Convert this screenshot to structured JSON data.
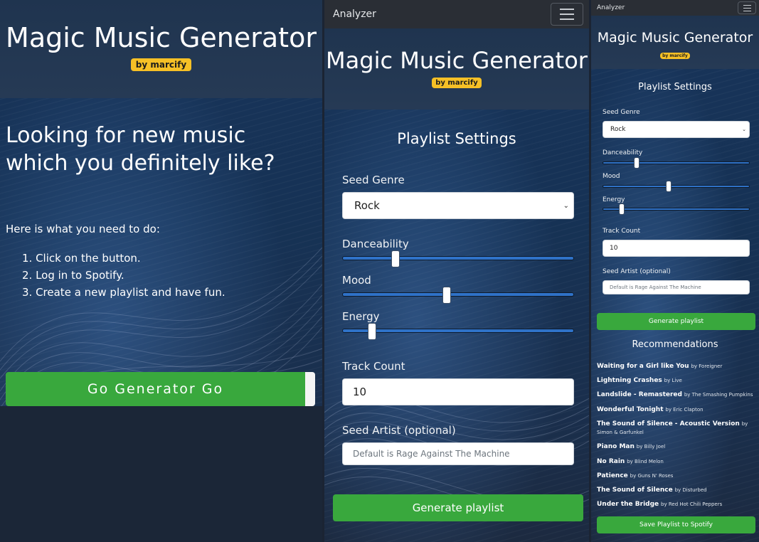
{
  "panel1": {
    "title": "Magic Music Generator",
    "badge": "by marcify",
    "headline": "Looking for new music which you definitely like?",
    "intro": "Here is what you need to do:",
    "steps": [
      "1. Click on the button.",
      "2. Log in to Spotify.",
      "3. Create a new playlist and have fun."
    ],
    "cta": "Go Generator Go"
  },
  "panel2": {
    "navbar": {
      "brand": "Analyzer",
      "menu_icon": "hamburger-icon"
    },
    "title": "Magic Music Generator",
    "badge": "by marcify",
    "settings_title": "Playlist Settings",
    "seed_genre_label": "Seed Genre",
    "seed_genre_value": "Rock",
    "danceability_label": "Danceability",
    "danceability_value": 0.23,
    "mood_label": "Mood",
    "mood_value": 0.45,
    "energy_label": "Energy",
    "energy_value": 0.13,
    "track_count_label": "Track Count",
    "track_count_value": "10",
    "seed_artist_label": "Seed Artist (optional)",
    "seed_artist_placeholder": "Default is Rage Against The Machine",
    "generate_label": "Generate playlist"
  },
  "panel3": {
    "navbar": {
      "brand": "Analyzer",
      "menu_icon": "hamburger-icon"
    },
    "title": "Magic Music Generator",
    "badge": "by marcify",
    "settings_title": "Playlist Settings",
    "seed_genre_label": "Seed Genre",
    "seed_genre_value": "Rock",
    "danceability_label": "Danceability",
    "danceability_value": 0.23,
    "mood_label": "Mood",
    "mood_value": 0.45,
    "energy_label": "Energy",
    "energy_value": 0.13,
    "track_count_label": "Track Count",
    "track_count_value": "10",
    "seed_artist_label": "Seed Artist (optional)",
    "seed_artist_placeholder": "Default is Rage Against The Machine",
    "generate_label": "Generate playlist",
    "recommendations_title": "Recommendations",
    "recommendations": [
      {
        "title": "Waiting for a Girl like You",
        "artist": "by Foreigner"
      },
      {
        "title": "Lightning Crashes",
        "artist": "by Live"
      },
      {
        "title": "Landslide - Remastered",
        "artist": "by The Smashing Pumpkins"
      },
      {
        "title": "Wonderful Tonight",
        "artist": "by Eric Clapton"
      },
      {
        "title": "The Sound of Silence - Acoustic Version",
        "artist": "by Simon & Garfunkel"
      },
      {
        "title": "Piano Man",
        "artist": "by Billy Joel"
      },
      {
        "title": "No Rain",
        "artist": "by Blind Melon"
      },
      {
        "title": "Patience",
        "artist": "by Guns N' Roses"
      },
      {
        "title": "The Sound of Silence",
        "artist": "by Disturbed"
      },
      {
        "title": "Under the Bridge",
        "artist": "by Red Hot Chili Peppers"
      }
    ],
    "save_label": "Save Playlist to Spotify"
  },
  "colors": {
    "accent_green": "#39a83d",
    "badge_yellow": "#f6c026",
    "slider_blue": "#2f72c8",
    "navbar": "#2a2e35"
  }
}
